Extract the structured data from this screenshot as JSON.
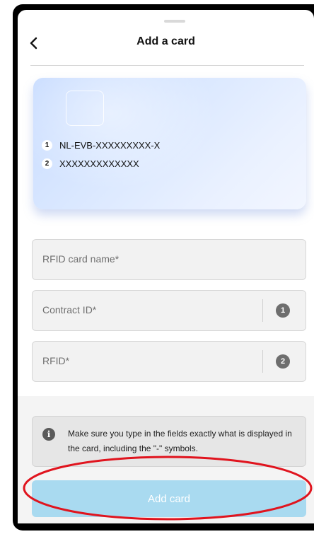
{
  "header": {
    "title": "Add a card",
    "back_icon": "chevron-left-icon"
  },
  "card": {
    "line1_index": "1",
    "line1_text": "NL-EVB-XXXXXXXXX-X",
    "line2_index": "2",
    "line2_text": "XXXXXXXXXXXXX"
  },
  "form": {
    "rfid_card_name_placeholder": "RFID card name*",
    "contract_id_placeholder": "Contract ID*",
    "contract_id_badge": "1",
    "rfid_placeholder": "RFID*",
    "rfid_badge": "2"
  },
  "info": {
    "icon": "info-icon",
    "text": "Make sure you type in the fields exactly what is displayed in the card, including the \"-\" symbols."
  },
  "actions": {
    "add_card_label": "Add card"
  },
  "colors": {
    "button_bg": "#a9daf0",
    "highlight_ellipse": "#e0141e",
    "card_gradient_start": "#c8dcff",
    "card_gradient_end": "#f2f6ff"
  }
}
